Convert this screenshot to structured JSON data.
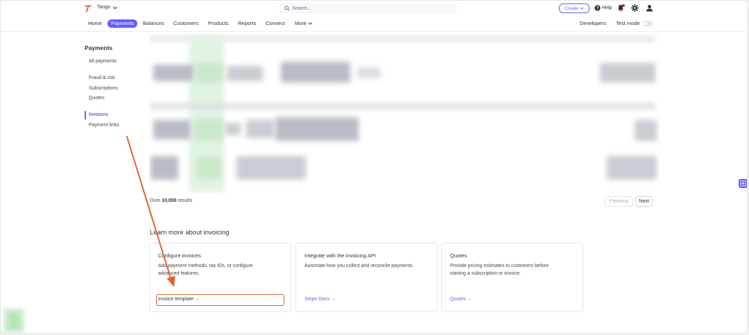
{
  "topbar": {
    "account_name": "Tango",
    "search_placeholder": "Search...",
    "create_label": "Create",
    "help_label": "Help"
  },
  "nav": {
    "items": [
      "Home",
      "Payments",
      "Balances",
      "Customers",
      "Products",
      "Reports",
      "Connect",
      "More"
    ],
    "active": "Payments",
    "developers_label": "Developers",
    "test_mode_label": "Test mode"
  },
  "sidebar": {
    "title": "Payments",
    "items": [
      "All payments",
      "Fraud & risk",
      "Subscriptions",
      "Quotes",
      "Invoices",
      "Payment links"
    ],
    "active": "Invoices"
  },
  "table": {
    "results_prefix": "Over",
    "results_count": "10,000",
    "results_suffix": "results",
    "prev_label": "Previous",
    "next_label": "Next"
  },
  "learn": {
    "title": "Learn more about invoicing",
    "cards": [
      {
        "title": "Configure invoices",
        "desc_line1": "Add payment methods, tax IDs, or configure",
        "desc_line2": "advanced features.",
        "link": "Invoice template →"
      },
      {
        "title": "Integrate with the Invoicing API",
        "desc_line1": "Automate how you collect and reconcile payments.",
        "desc_line2": "",
        "link": "Stripe Docs →"
      },
      {
        "title": "Quotes",
        "desc_line1": "Provide pricing estimates to customers before",
        "desc_line2": "starting a subscription or invoice.",
        "link": "Quotes →"
      }
    ]
  },
  "colors": {
    "accent": "#635bff",
    "annotation": "#e0632e"
  },
  "icons": [
    "tango-logo-icon",
    "chevron-down-icon",
    "search-icon",
    "help-icon",
    "bell-icon",
    "gear-icon",
    "user-icon",
    "plus-icon"
  ]
}
